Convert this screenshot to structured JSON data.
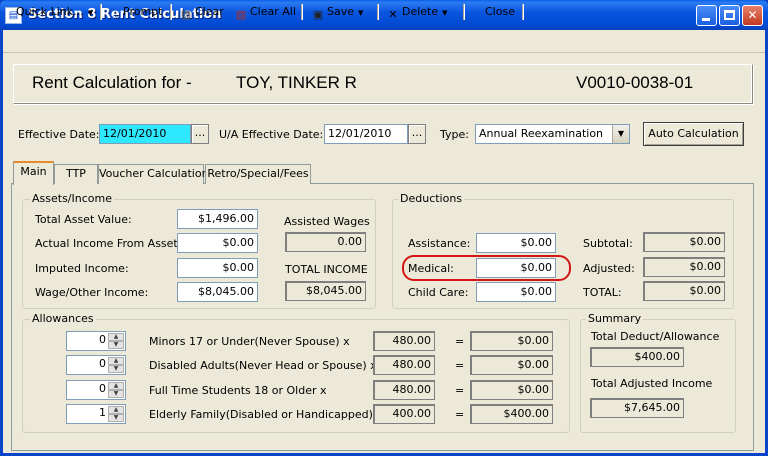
{
  "window": {
    "title": "Section 8 Rent Calculation"
  },
  "toolbar": {
    "quick_link": "Quick Link...",
    "prompt": "Prompt",
    "clear": "Clear",
    "clear_all": "Clear All",
    "save": "Save",
    "delete": "Delete",
    "close": "Close"
  },
  "header": {
    "label": "Rent Calculation for -",
    "tenant_name": "TOY, TINKER R",
    "tenant_id": "V0010-0038-01"
  },
  "dates": {
    "effective_label": "Effective Date:",
    "effective_value": "12/01/2010",
    "ua_label": "U/A Effective Date:",
    "ua_value": "12/01/2010",
    "type_label": "Type:",
    "type_value": "Annual Reexamination",
    "auto_calc": "Auto Calculation",
    "ellipsis": "..."
  },
  "tabs": [
    "Main",
    "TTP",
    "Voucher Calculation",
    "Retro/Special/Fees"
  ],
  "assets": {
    "title": "Assets/Income",
    "rows": [
      {
        "label": "Total Asset Value:",
        "value": "$1,496.00"
      },
      {
        "label": "Actual Income From Assets:",
        "value": "$0.00"
      },
      {
        "label": "Imputed Income:",
        "value": "$0.00"
      },
      {
        "label": "Wage/Other Income:",
        "value": "$8,045.00"
      }
    ],
    "assisted_wages_label": "Assisted Wages",
    "assisted_wages_value": "0.00",
    "total_income_label": "TOTAL INCOME",
    "total_income_value": "$8,045.00"
  },
  "deductions": {
    "title": "Deductions",
    "rows": [
      {
        "label": "Assistance:",
        "value": "$0.00"
      },
      {
        "label": "Medical:",
        "value": "$0.00"
      },
      {
        "label": "Child Care:",
        "value": "$0.00"
      }
    ],
    "totals": [
      {
        "label": "Subtotal:",
        "value": "$0.00"
      },
      {
        "label": "Adjusted:",
        "value": "$0.00"
      },
      {
        "label": "TOTAL:",
        "value": "$0.00"
      }
    ]
  },
  "allowances": {
    "title": "Allowances",
    "equals": "=",
    "rows": [
      {
        "count": "0",
        "label": "Minors 17 or Under(Never Spouse) x",
        "rate": "480.00",
        "result": "$0.00"
      },
      {
        "count": "0",
        "label": "Disabled Adults(Never Head or Spouse) x",
        "rate": "480.00",
        "result": "$0.00"
      },
      {
        "count": "0",
        "label": "Full Time Students 18 or Older x",
        "rate": "480.00",
        "result": "$0.00"
      },
      {
        "count": "1",
        "label": "Elderly Family(Disabled or Handicapped) x",
        "rate": "400.00",
        "result": "$400.00"
      }
    ]
  },
  "summary": {
    "title": "Summary",
    "deduct_allowance_label": "Total Deduct/Allowance",
    "deduct_allowance_value": "$400.00",
    "adjusted_income_label": "Total Adjusted Income",
    "adjusted_income_value": "$7,645.00"
  },
  "icons": {
    "prompt": "magnifier-icon",
    "clear": "clear-icon",
    "clear_all": "clear-all-icon",
    "save": "floppy-disk-icon",
    "delete": "x-icon"
  },
  "colors": {
    "title_bar": "#0a56e0",
    "selection": "#2ee8ff",
    "highlight_oval": "#d41515",
    "active_tab": "#e68b2c"
  }
}
